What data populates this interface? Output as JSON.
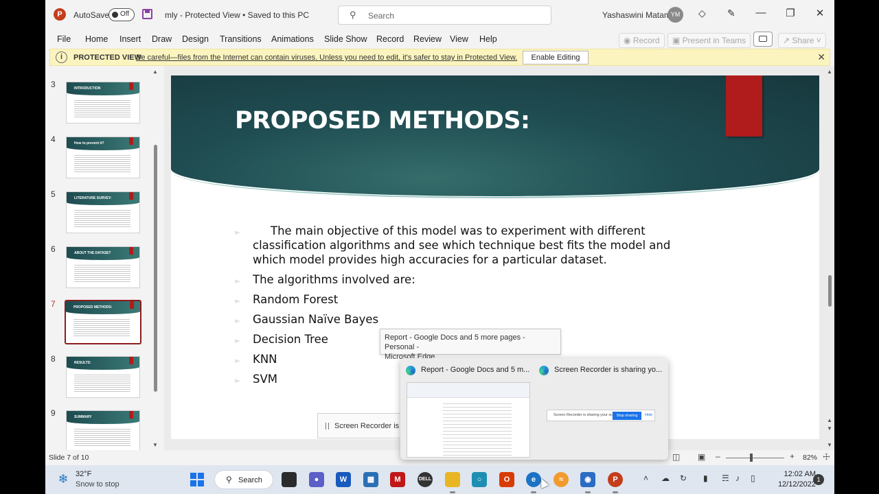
{
  "app": {
    "logo": "P",
    "autosave_label": "AutoSave",
    "autosave_state": "Off",
    "doc_title": "mly  -  Protected View  •  Saved to this PC",
    "search_placeholder": "Search",
    "user_name": "Yashaswini Matam",
    "user_initials": "YM"
  },
  "menu": {
    "items": [
      "File",
      "Home",
      "Insert",
      "Draw",
      "Design",
      "Transitions",
      "Animations",
      "Slide Show",
      "Record",
      "Review",
      "View",
      "Help"
    ],
    "record_btn": "Record",
    "present_btn": "Present in Teams",
    "share_btn": "Share"
  },
  "protected_view": {
    "label": "PROTECTED VIEW",
    "message": "Be careful—files from the Internet can contain viruses. Unless you need to edit, it's safer to stay in Protected View.",
    "enable_button": "Enable Editing"
  },
  "thumbnails": [
    {
      "num": "3",
      "title": "INTRODUCTION"
    },
    {
      "num": "4",
      "title": "How to prevent it?"
    },
    {
      "num": "5",
      "title": "LITERATURE SURVEY:"
    },
    {
      "num": "6",
      "title": "ABOUT THE DATASET"
    },
    {
      "num": "7",
      "title": "PROPOSED METHODS:"
    },
    {
      "num": "8",
      "title": "RESULTS:"
    },
    {
      "num": "9",
      "title": "SUMMARY"
    }
  ],
  "slide": {
    "title": "PROPOSED METHODS:",
    "paragraph": "The main objective of this model was to experiment with different classification algorithms and see which technique best fits the model and which model provides high accuracies for a particular dataset.",
    "intro": "The algorithms involved are:",
    "items": [
      "Random Forest",
      "Gaussian Naïve Bayes",
      "Decision Tree",
      "KNN",
      "SVM"
    ]
  },
  "status": {
    "slide_no": "Slide 7 of 10",
    "zoom": "82%"
  },
  "tooltip": {
    "line1": "Report - Google Docs and 5 more pages - Personal -",
    "line2": "Microsoft Edge"
  },
  "preview": {
    "tab1": "Report - Google Docs and 5 m...",
    "tab2": "Screen Recorder is sharing yo...",
    "share_text": "Screen Recorder is sharing your screen.",
    "stop_sharing": "Stop sharing",
    "hide": "Hide",
    "recorder_popup": "Screen Recorder is sh"
  },
  "taskbar": {
    "temp": "32°F",
    "weather": "Snow to stop",
    "search_label": "Search",
    "time": "12:02 AM",
    "date": "12/12/2022",
    "notifications": "1"
  }
}
